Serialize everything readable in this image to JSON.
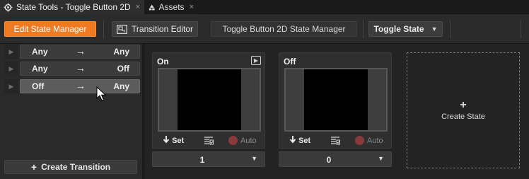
{
  "tabs": [
    {
      "label": "State Tools - Toggle Button 2D",
      "close": "×"
    },
    {
      "label": "Assets",
      "close": "×"
    }
  ],
  "toolbar": {
    "edit_state_manager": "Edit State Manager",
    "transition_editor": "Transition Editor",
    "state_manager_name": "Toggle Button 2D State Manager",
    "state_group": "Toggle State",
    "dropdown_glyph": "▼"
  },
  "transitions": [
    {
      "from": "Any",
      "arrow": "→",
      "to": "Any",
      "expand": "▶"
    },
    {
      "from": "Any",
      "arrow": "→",
      "to": "Off",
      "expand": "▶"
    },
    {
      "from": "Off",
      "arrow": "→",
      "to": "Any",
      "expand": "▶"
    }
  ],
  "create_transition": {
    "icon": "+",
    "label": "Create Transition"
  },
  "states": [
    {
      "name": "On",
      "set_label": "Set",
      "auto_label": "Auto",
      "value": "1",
      "preview_icon": "▶"
    },
    {
      "name": "Off",
      "set_label": "Set",
      "auto_label": "Auto",
      "value": "0"
    }
  ],
  "create_state": {
    "icon": "+",
    "label": "Create State"
  },
  "colors": {
    "accent": "#f07a21",
    "background": "#1f1f1f",
    "panel": "#2a2a2a",
    "auto_dot": "#8a3a3a"
  }
}
